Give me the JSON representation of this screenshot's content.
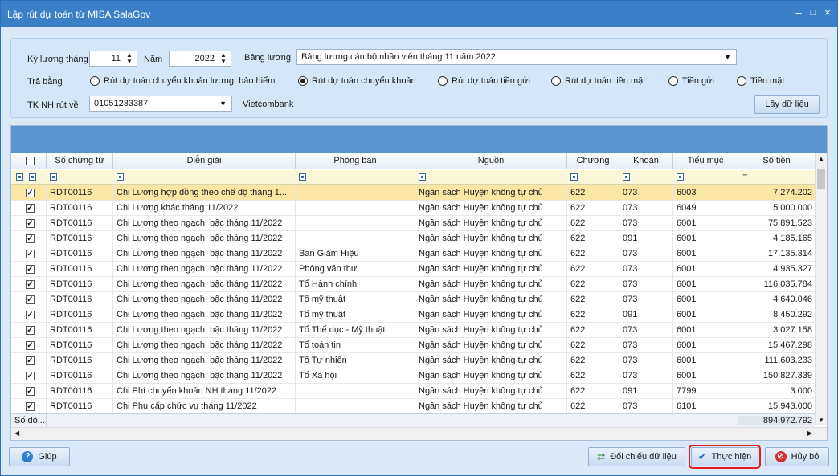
{
  "window": {
    "title": "Lập rút dự toán từ MISA SalaGov",
    "min": "–",
    "max": "□",
    "close": "×"
  },
  "form": {
    "ky_luong_label": "Kỳ lương tháng",
    "ky_luong_value": "11",
    "nam_label": "Năm",
    "nam_value": "2022",
    "bang_luong_label": "Bảng lương",
    "bang_luong_value": "Bảng lương cán bộ nhân viên tháng 11 năm 2022",
    "tra_bang_label": "Trả bằng",
    "radios": [
      {
        "label": "Rút dự toán chuyển khoản lương, bảo hiểm",
        "selected": false
      },
      {
        "label": "Rút dự toán chuyển khoản",
        "selected": true
      },
      {
        "label": "Rút dự toán tiền gửi",
        "selected": false
      },
      {
        "label": "Rút dự toán tiền mặt",
        "selected": false
      },
      {
        "label": "Tiền gửi",
        "selected": false
      },
      {
        "label": "Tiền mặt",
        "selected": false
      }
    ],
    "tk_label": "TK NH rút về",
    "tk_value": "01051233387",
    "bank_name": "Vietcombank",
    "lay_du_lieu": "Lấy dữ liệu"
  },
  "grid": {
    "columns": [
      "Số chứng từ",
      "Diễn giải",
      "Phòng ban",
      "Nguồn",
      "Chương",
      "Khoản",
      "Tiểu mục",
      "Số tiền"
    ],
    "filter_equal": "=",
    "rows": [
      {
        "so": "RDT00116",
        "dien_giai": "Chi Lương hợp đồng theo chế độ tháng 1...",
        "phong_ban": "",
        "nguon": "Ngân sách Huyện không tự chủ",
        "chuong": "622",
        "khoan": "073",
        "tieu_muc": "6003",
        "so_tien": "7.274.202",
        "selected": true
      },
      {
        "so": "RDT00116",
        "dien_giai": "Chi Lương khác tháng 11/2022",
        "phong_ban": "",
        "nguon": "Ngân sách Huyện không tự chủ",
        "chuong": "622",
        "khoan": "073",
        "tieu_muc": "6049",
        "so_tien": "5.000.000"
      },
      {
        "so": "RDT00116",
        "dien_giai": "Chi Lương theo ngạch, bậc tháng 11/2022",
        "phong_ban": "",
        "nguon": "Ngân sách Huyện không tự chủ",
        "chuong": "622",
        "khoan": "073",
        "tieu_muc": "6001",
        "so_tien": "75.891.523"
      },
      {
        "so": "RDT00116",
        "dien_giai": "Chi Lương theo ngạch, bậc tháng 11/2022",
        "phong_ban": "",
        "nguon": "Ngân sách Huyện không tự chủ",
        "chuong": "622",
        "khoan": "091",
        "tieu_muc": "6001",
        "so_tien": "4.185.165"
      },
      {
        "so": "RDT00116",
        "dien_giai": "Chi Lương theo ngạch, bậc tháng 11/2022",
        "phong_ban": "Ban Giám Hiệu",
        "nguon": "Ngân sách Huyện không tự chủ",
        "chuong": "622",
        "khoan": "073",
        "tieu_muc": "6001",
        "so_tien": "17.135.314"
      },
      {
        "so": "RDT00116",
        "dien_giai": "Chi Lương theo ngạch, bậc tháng 11/2022",
        "phong_ban": "Phòng văn thư",
        "nguon": "Ngân sách Huyện không tự chủ",
        "chuong": "622",
        "khoan": "073",
        "tieu_muc": "6001",
        "so_tien": "4.935.327"
      },
      {
        "so": "RDT00116",
        "dien_giai": "Chi Lương theo ngạch, bậc tháng 11/2022",
        "phong_ban": "Tổ Hành chính",
        "nguon": "Ngân sách Huyện không tự chủ",
        "chuong": "622",
        "khoan": "073",
        "tieu_muc": "6001",
        "so_tien": "116.035.784"
      },
      {
        "so": "RDT00116",
        "dien_giai": "Chi Lương theo ngạch, bậc tháng 11/2022",
        "phong_ban": "Tổ mỹ thuật",
        "nguon": "Ngân sách Huyện không tự chủ",
        "chuong": "622",
        "khoan": "073",
        "tieu_muc": "6001",
        "so_tien": "4.640.046"
      },
      {
        "so": "RDT00116",
        "dien_giai": "Chi Lương theo ngạch, bậc tháng 11/2022",
        "phong_ban": "Tổ mỹ thuật",
        "nguon": "Ngân sách Huyện không tự chủ",
        "chuong": "622",
        "khoan": "091",
        "tieu_muc": "6001",
        "so_tien": "8.450.292"
      },
      {
        "so": "RDT00116",
        "dien_giai": "Chi Lương theo ngạch, bậc tháng 11/2022",
        "phong_ban": "Tổ Thể dục - Mỹ thuật",
        "nguon": "Ngân sách Huyện không tự chủ",
        "chuong": "622",
        "khoan": "073",
        "tieu_muc": "6001",
        "so_tien": "3.027.158"
      },
      {
        "so": "RDT00116",
        "dien_giai": "Chi Lương theo ngạch, bậc tháng 11/2022",
        "phong_ban": "Tổ toán tin",
        "nguon": "Ngân sách Huyện không tự chủ",
        "chuong": "622",
        "khoan": "073",
        "tieu_muc": "6001",
        "so_tien": "15.467.298"
      },
      {
        "so": "RDT00116",
        "dien_giai": "Chi Lương theo ngạch, bậc tháng 11/2022",
        "phong_ban": "Tổ Tự nhiên",
        "nguon": "Ngân sách Huyện không tự chủ",
        "chuong": "622",
        "khoan": "073",
        "tieu_muc": "6001",
        "so_tien": "111.603.233"
      },
      {
        "so": "RDT00116",
        "dien_giai": "Chi Lương theo ngạch, bậc tháng 11/2022",
        "phong_ban": "Tổ Xã hội",
        "nguon": "Ngân sách Huyện không tự chủ",
        "chuong": "622",
        "khoan": "073",
        "tieu_muc": "6001",
        "so_tien": "150.827.339"
      },
      {
        "so": "RDT00116",
        "dien_giai": "Chi Phí chuyển khoản NH tháng 11/2022",
        "phong_ban": "",
        "nguon": "Ngân sách Huyện không tự chủ",
        "chuong": "622",
        "khoan": "091",
        "tieu_muc": "7799",
        "so_tien": "3.000"
      },
      {
        "so": "RDT00116",
        "dien_giai": "Chi Phụ cấp chức vụ tháng 11/2022",
        "phong_ban": "",
        "nguon": "Ngân sách Huyện không tự chủ",
        "chuong": "622",
        "khoan": "073",
        "tieu_muc": "6101",
        "so_tien": "15.943.000"
      }
    ],
    "footer_label": "Số dò...",
    "footer_total": "894.972.792"
  },
  "buttons": {
    "giup": "Giúp",
    "doi_chieu": "Đối chiếu dữ liệu",
    "thuc_hien": "Thực hiện",
    "huy_bo": "Hủy bỏ"
  },
  "colors": {
    "title_bar": "#3a7fc8",
    "highlight_outline": "#e02020",
    "selected_row": "#fbe6a6"
  }
}
